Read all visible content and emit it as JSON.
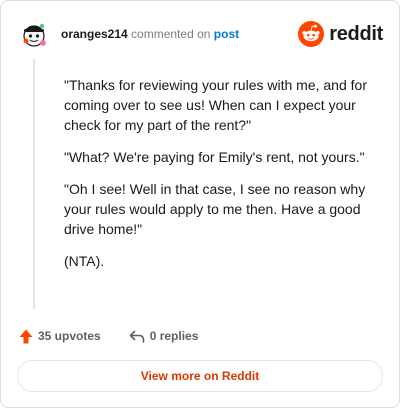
{
  "header": {
    "username": "oranges214",
    "action_text": "commented on",
    "post_link_text": "post",
    "logo_text": "reddit"
  },
  "comment": {
    "paragraphs": [
      "\"Thanks for reviewing your rules with me, and for coming over to see us! When can I expect your check for my part of the rent?\"",
      "\"What? We're paying for Emily's rent, not yours.\"",
      "\"Oh I see! Well in that case, I see no reason why your rules would apply to me then. Have a good drive home!\"",
      "(NTA)."
    ]
  },
  "footer": {
    "upvotes": "35 upvotes",
    "replies": "0 replies"
  },
  "view_more_label": "View more on Reddit",
  "colors": {
    "accent": "#d93900",
    "upvote": "#ff4500",
    "link": "#0079d3"
  },
  "icons": [
    "avatar-icon",
    "reddit-logo-icon",
    "upvote-arrow-icon",
    "reply-icon"
  ]
}
